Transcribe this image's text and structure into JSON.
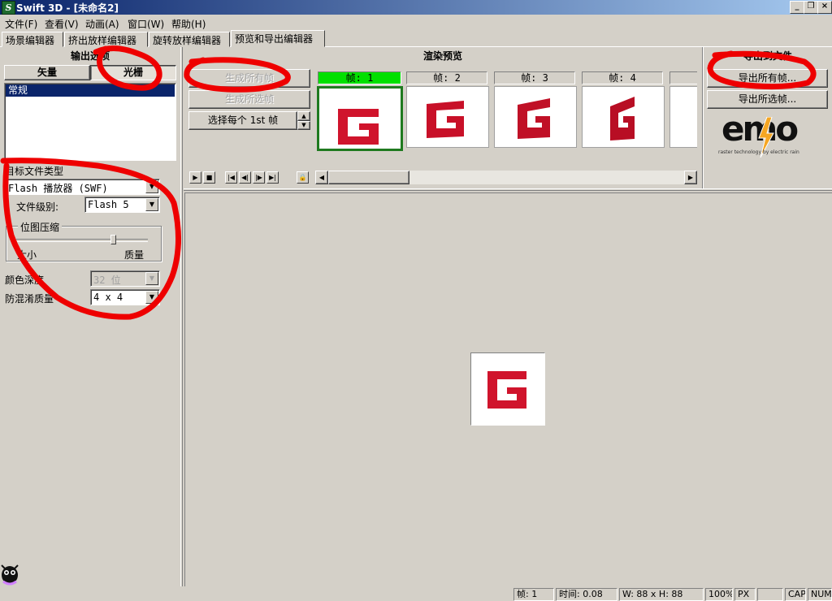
{
  "window": {
    "title": "Swift 3D - [未命名2]",
    "icon": "S",
    "controls": {
      "minimize": "_",
      "restore": "❐",
      "close": "×"
    }
  },
  "menu": [
    "文件(F)",
    "查看(V)",
    "动画(A)",
    "窗口(W)",
    "帮助(H)"
  ],
  "tabs": [
    "场景编辑器",
    "挤出放样编辑器",
    "旋转放样编辑器",
    "预览和导出编辑器"
  ],
  "left_panel": {
    "header": "输出选项",
    "type_buttons": {
      "vector": "矢量",
      "raster": "光栅"
    },
    "list_items": [
      "常规"
    ],
    "target_type_label": "目标文件类型",
    "target_type_value": "Flash 播放器 (SWF)",
    "file_level_label": "文件级别:",
    "file_level_value": "Flash 5",
    "compression_group": "位图压缩",
    "slider_min_label": "大小",
    "slider_max_label": "质量",
    "slider_value": 0.75,
    "color_depth_label": "颜色深度",
    "color_depth_value": "32 位",
    "antialias_label": "防混淆质量",
    "antialias_value": "4 x 4"
  },
  "render_panel": {
    "header": "渲染预览",
    "generate_all": "生成所有帧",
    "generate_selected": "生成所选帧",
    "select_every": "选择每个  1st  帧",
    "frames": [
      {
        "label": "帧: 1",
        "selected": true
      },
      {
        "label": "帧: 2",
        "selected": false
      },
      {
        "label": "帧: 3",
        "selected": false
      },
      {
        "label": "帧: 4",
        "selected": false
      }
    ]
  },
  "export_panel": {
    "header": "导出到文件",
    "export_all": "导出所有帧...",
    "export_selected": "导出所选帧...",
    "logo_text": "emo",
    "logo_tagline": "raster technology by electric rain"
  },
  "status": {
    "frame": "帧: 1",
    "time": "时间: 0.08",
    "size": "W: 88 x H: 88",
    "zoom": "100%",
    "unit": "PX",
    "caps": "CAP",
    "num": "NUM"
  },
  "colors": {
    "accent": "#d0142c",
    "selected_frame": "#00e000",
    "title_start": "#0a246a",
    "title_end": "#a6caf0",
    "annotation": "#ee0000"
  }
}
